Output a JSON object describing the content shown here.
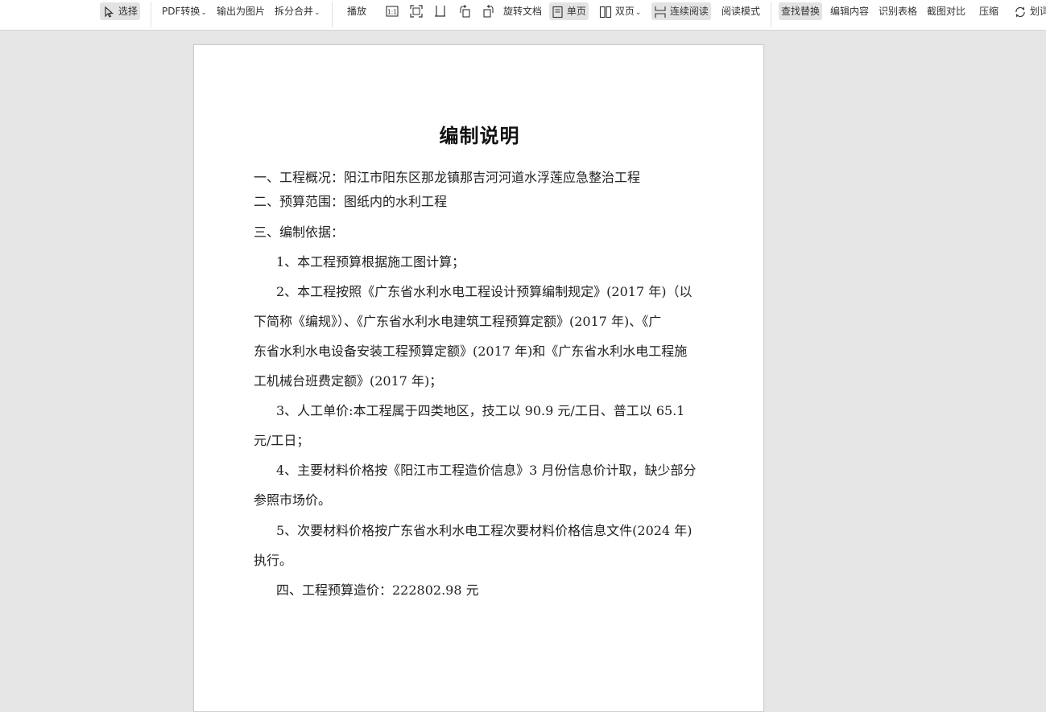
{
  "toolbar": {
    "select": "选择",
    "pdf_convert": "PDF转换",
    "export_image": "输出为图片",
    "split_merge": "拆分合并",
    "play": "播放",
    "rotate_doc": "旋转文档",
    "single_page": "单页",
    "double_page": "双页",
    "continuous_read": "连续阅读",
    "read_mode": "阅读模式",
    "find_replace": "查找替换",
    "edit_content": "编辑内容",
    "recognize_table": "识别表格",
    "screenshot_compare": "截图对比",
    "compress": "压缩",
    "word_mark": "划词",
    "actual_size_icon_text": "1:1",
    "icons": [
      "actual-size-icon",
      "fit-page-icon",
      "fit-width-icon",
      "rotate-left-icon",
      "rotate-right-icon"
    ]
  },
  "document": {
    "title": "编制说明",
    "lines": [
      "一、工程概况：阳江市阳东区那龙镇那吉河河道水浮莲应急整治工程",
      "二、预算范围：图纸内的水利工程",
      "三、编制依据：",
      "1、本工程预算根据施工图计算；",
      "2、本工程按照《广东省水利水电工程设计预算编制规定》(2017 年)（以",
      "下简称《编规》）、《广东省水利水电建筑工程预算定额》(2017 年)、《广",
      "东省水利水电设备安装工程预算定额》(2017 年)和《广东省水利水电工程施",
      "工机械台班费定额》(2017 年)；",
      "3、人工单价:本工程属于四类地区，技工以 90.9 元/工日、普工以 65.1",
      "元/工日；",
      "4、主要材料价格按《阳江市工程造价信息》3 月份信息价计取，缺少部分",
      "参照市场价。",
      "5、次要材料价格按广东省水利水电工程次要材料价格信息文件(2024 年)",
      "执行。",
      "四、工程预算造价：222802.98 元"
    ]
  }
}
